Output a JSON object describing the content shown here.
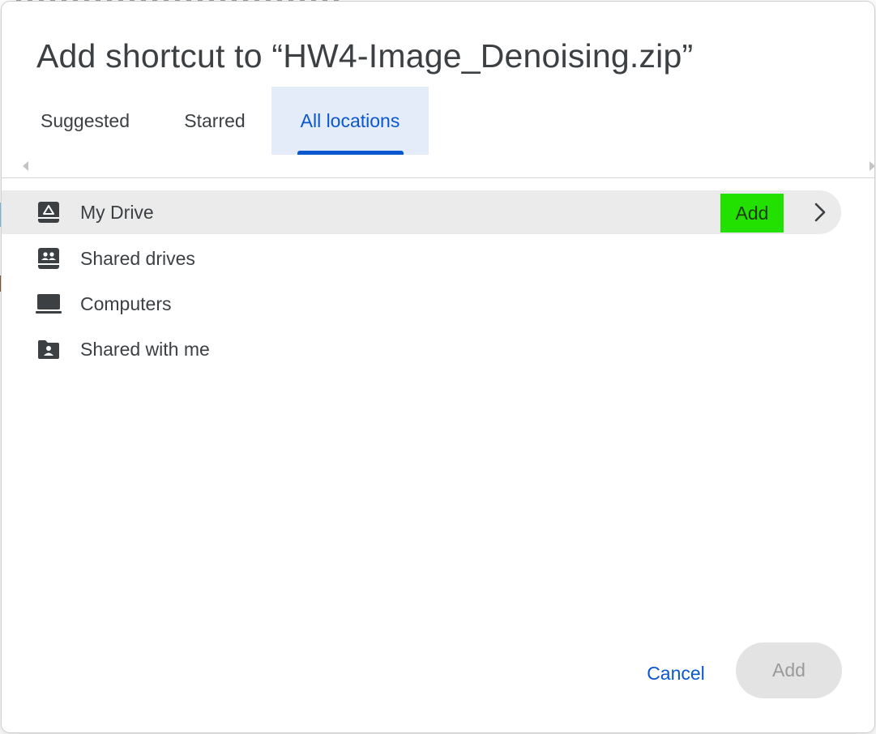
{
  "dialog": {
    "title": "Add shortcut to “HW4-Image_Denoising.zip”"
  },
  "tabs": [
    {
      "label": "Suggested",
      "active": false
    },
    {
      "label": "Starred",
      "active": false
    },
    {
      "label": "All locations",
      "active": true
    }
  ],
  "locations": [
    {
      "label": "My Drive",
      "icon": "my-drive-icon",
      "selected": true,
      "action_label": "Add"
    },
    {
      "label": "Shared drives",
      "icon": "shared-drives-icon"
    },
    {
      "label": "Computers",
      "icon": "computer-icon"
    },
    {
      "label": "Shared with me",
      "icon": "shared-with-me-icon"
    }
  ],
  "footer": {
    "cancel_label": "Cancel",
    "add_label": "Add",
    "add_disabled": true
  },
  "colors": {
    "accent": "#0b57d0",
    "tab_active_bg": "#e3ecf8",
    "inline_add_bg": "#22e000",
    "selected_row_bg": "#ebebeb"
  }
}
